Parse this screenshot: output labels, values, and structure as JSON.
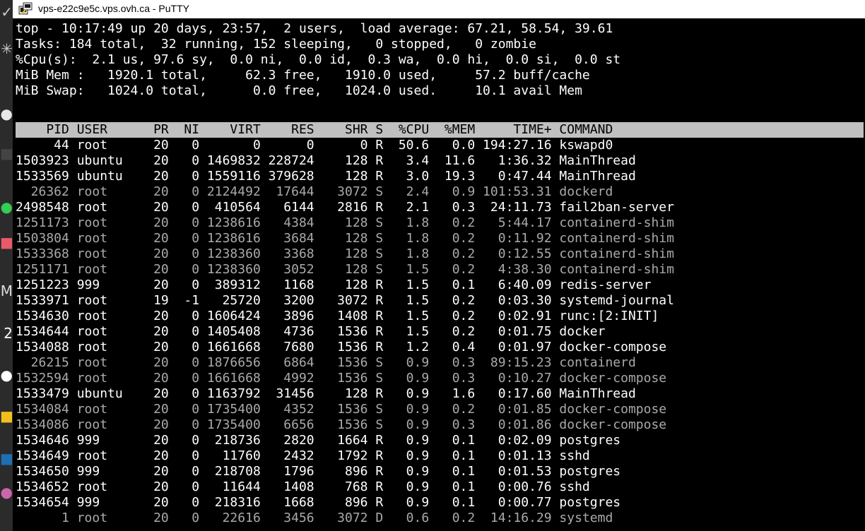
{
  "window": {
    "title": "vps-e22c9e5c.vps.ovh.ca - PuTTY"
  },
  "taskbar": {
    "icons": [
      {
        "name": "check-icon",
        "glyph": "✓",
        "color": "#cccccc"
      },
      {
        "name": "asterisk-icon",
        "glyph": "✳",
        "color": "#cccccc"
      },
      {
        "name": "app-icon",
        "glyph": "●",
        "color": "#e8e8e8"
      },
      {
        "name": "app-icon",
        "glyph": "■",
        "color": "#444444"
      },
      {
        "name": "app-icon",
        "glyph": "●",
        "color": "#33cc55"
      },
      {
        "name": "app-icon",
        "glyph": "■",
        "color": "#e85a6a"
      },
      {
        "name": "app-icon",
        "glyph": "M",
        "color": "#dddddd"
      },
      {
        "name": "app-icon",
        "glyph": "2",
        "color": "#ffffff"
      },
      {
        "name": "app-icon",
        "glyph": "●",
        "color": "#ffffff"
      },
      {
        "name": "app-icon",
        "glyph": "■",
        "color": "#f2c01e"
      },
      {
        "name": "app-icon",
        "glyph": "■",
        "color": "#1f6fb2"
      },
      {
        "name": "app-icon",
        "glyph": "●",
        "color": "#cc66aa"
      }
    ]
  },
  "terminal": {
    "summary": [
      "top - 10:17:49 up 20 days, 23:57,  2 users,  load average: 67.21, 58.54, 39.61",
      "Tasks: 184 total,  32 running, 152 sleeping,   0 stopped,   0 zombie",
      "%Cpu(s):  2.1 us, 97.6 sy,  0.0 ni,  0.0 id,  0.3 wa,  0.0 hi,  0.0 si,  0.0 st",
      "MiB Mem :   1920.1 total,     62.3 free,   1910.0 used,     57.2 buff/cache",
      "MiB Swap:   1024.0 total,      0.0 free,   1024.0 used.     10.1 avail Mem"
    ],
    "header": "    PID USER      PR  NI    VIRT    RES    SHR S  %CPU  %MEM     TIME+ COMMAND",
    "processes": [
      {
        "text": "     44 root      20   0       0      0      0 R  50.6   0.0 194:27.16 kswapd0",
        "state": "R"
      },
      {
        "text": "1503923 ubuntu    20   0 1469832 228724    128 R   3.4  11.6   1:36.32 MainThread",
        "state": "R"
      },
      {
        "text": "1533569 ubuntu    20   0 1559116 379628    128 R   3.0  19.3   0:47.44 MainThread",
        "state": "R"
      },
      {
        "text": "  26362 root      20   0 2124492  17644   3072 S   2.4   0.9 101:53.31 dockerd",
        "state": "S"
      },
      {
        "text": "2498548 root      20   0  410564   6144   2816 R   2.1   0.3  24:11.73 fail2ban-server",
        "state": "R"
      },
      {
        "text": "1251173 root      20   0 1238616   4384    128 S   1.8   0.2   5:44.17 containerd-shim",
        "state": "S"
      },
      {
        "text": "1503804 root      20   0 1238616   3684    128 S   1.8   0.2   0:11.92 containerd-shim",
        "state": "S"
      },
      {
        "text": "1533368 root      20   0 1238360   3368    128 S   1.8   0.2   0:12.55 containerd-shim",
        "state": "S"
      },
      {
        "text": "1251171 root      20   0 1238360   3052    128 S   1.5   0.2   4:38.30 containerd-shim",
        "state": "S"
      },
      {
        "text": "1251223 999       20   0  389312   1168    128 R   1.5   0.1   6:40.09 redis-server",
        "state": "R"
      },
      {
        "text": "1533971 root      19  -1   25720   3200   3072 R   1.5   0.2   0:03.30 systemd-journal",
        "state": "R"
      },
      {
        "text": "1534630 root      20   0 1606424   3896   1408 R   1.5   0.2   0:02.91 runc:[2:INIT]",
        "state": "R"
      },
      {
        "text": "1534644 root      20   0 1405408   4736   1536 R   1.5   0.2   0:01.75 docker",
        "state": "R"
      },
      {
        "text": "1534088 root      20   0 1661668   7680   1536 R   1.2   0.4   0:01.97 docker-compose",
        "state": "R"
      },
      {
        "text": "  26215 root      20   0 1876656   6864   1536 S   0.9   0.3  89:15.23 containerd",
        "state": "S"
      },
      {
        "text": "1532594 root      20   0 1661668   4992   1536 S   0.9   0.3   0:10.27 docker-compose",
        "state": "S"
      },
      {
        "text": "1533479 ubuntu    20   0 1163792  31456    128 R   0.9   1.6   0:17.60 MainThread",
        "state": "R"
      },
      {
        "text": "1534084 root      20   0 1735400   4352   1536 S   0.9   0.2   0:01.85 docker-compose",
        "state": "S"
      },
      {
        "text": "1534086 root      20   0 1735400   6656   1536 S   0.9   0.3   0:01.86 docker-compose",
        "state": "S"
      },
      {
        "text": "1534646 999       20   0  218736   2820   1664 R   0.9   0.1   0:02.09 postgres",
        "state": "R"
      },
      {
        "text": "1534649 root      20   0   11760   2432   1792 R   0.9   0.1   0:01.13 sshd",
        "state": "R"
      },
      {
        "text": "1534650 999       20   0  218708   1796    896 R   0.9   0.1   0:01.53 postgres",
        "state": "R"
      },
      {
        "text": "1534652 root      20   0   11644   1408    768 R   0.9   0.1   0:00.76 sshd",
        "state": "R"
      },
      {
        "text": "1534654 999       20   0  218316   1668    896 R   0.9   0.1   0:00.77 postgres",
        "state": "R"
      },
      {
        "text": "      1 root      20   0   22616   3456   3072 D   0.6   0.2  14:16.29 systemd",
        "state": "D"
      }
    ]
  }
}
